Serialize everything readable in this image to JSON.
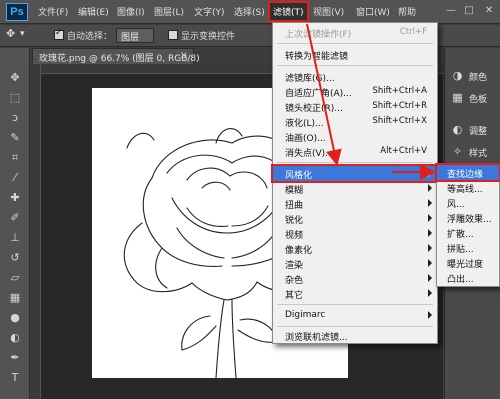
{
  "app": {
    "logo": "Ps"
  },
  "menubar": {
    "items": [
      "文件(F)",
      "编辑(E)",
      "图像(I)",
      "图层(L)",
      "文字(Y)",
      "选择(S)",
      "滤镜(T)",
      "视图(V)",
      "窗口(W)",
      "帮助"
    ],
    "active_index": 6
  },
  "window_controls": {
    "minimize": "—",
    "restore": "□",
    "close": "✕"
  },
  "options_bar": {
    "auto_select_label": "自动选择：",
    "auto_select_value": "图层",
    "show_transform_label": "显示变换控件"
  },
  "document": {
    "tab_title": "玫瑰花.png @ 66.7% (图层 0, RGB/8)",
    "close_glyph": "×"
  },
  "panels": [
    {
      "icon": "color-icon",
      "label": "颜色"
    },
    {
      "icon": "swatches-icon",
      "label": "色板"
    },
    {
      "icon": "adjustments-icon",
      "label": "调整"
    },
    {
      "icon": "styles-icon",
      "label": "样式"
    }
  ],
  "filter_menu": {
    "items": [
      {
        "label": "上次滤镜操作(F)",
        "shortcut": "Ctrl+F",
        "disabled": true
      },
      {
        "label": "转换为智能滤镜"
      },
      {
        "label": "滤镜库(G)..."
      },
      {
        "label": "自适应广角(A)...",
        "shortcut": "Shift+Ctrl+A"
      },
      {
        "label": "镜头校正(R)...",
        "shortcut": "Shift+Ctrl+R"
      },
      {
        "label": "液化(L)...",
        "shortcut": "Shift+Ctrl+X"
      },
      {
        "label": "油画(O)..."
      },
      {
        "label": "消失点(V)...",
        "shortcut": "Alt+Ctrl+V"
      },
      {
        "label": "风格化",
        "submenu": true,
        "highlight": true
      },
      {
        "label": "模糊",
        "submenu": true
      },
      {
        "label": "扭曲",
        "submenu": true
      },
      {
        "label": "锐化",
        "submenu": true
      },
      {
        "label": "视频",
        "submenu": true
      },
      {
        "label": "像素化",
        "submenu": true
      },
      {
        "label": "渲染",
        "submenu": true
      },
      {
        "label": "杂色",
        "submenu": true
      },
      {
        "label": "其它",
        "submenu": true
      },
      {
        "label": "Digimarc",
        "submenu": true
      },
      {
        "label": "浏览联机滤镜..."
      }
    ]
  },
  "stylize_submenu": {
    "items": [
      "查找边缘",
      "等高线...",
      "风...",
      "浮雕效果...",
      "扩散...",
      "拼贴...",
      "曝光过度",
      "凸出..."
    ],
    "selected_index": 0
  },
  "colors": {
    "highlight_blue": "#3b78d9",
    "annotation_red": "#e0201c"
  }
}
